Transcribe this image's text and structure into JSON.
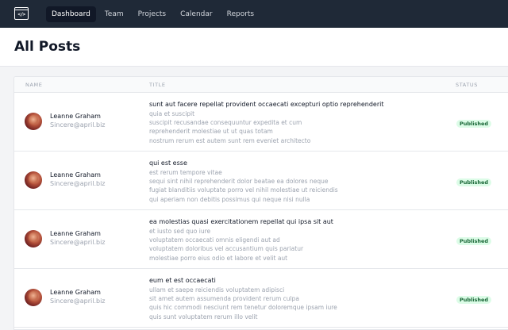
{
  "nav": {
    "logo_glyph": "</>",
    "links": [
      {
        "label": "Dashboard",
        "active": true
      },
      {
        "label": "Team",
        "active": false
      },
      {
        "label": "Projects",
        "active": false
      },
      {
        "label": "Calendar",
        "active": false
      },
      {
        "label": "Reports",
        "active": false
      }
    ]
  },
  "page": {
    "title": "All Posts"
  },
  "table": {
    "headers": {
      "name": "NAME",
      "title": "TITLE",
      "status": "STATUS"
    },
    "rows": [
      {
        "name": "Leanne Graham",
        "email": "Sincere@april.biz",
        "title": "sunt aut facere repellat provident occaecati excepturi optio reprehenderit",
        "body": [
          "quia et suscipit",
          "suscipit recusandae consequuntur expedita et cum",
          "reprehenderit molestiae ut ut quas totam",
          "nostrum rerum est autem sunt rem eveniet architecto"
        ],
        "status": "Published"
      },
      {
        "name": "Leanne Graham",
        "email": "Sincere@april.biz",
        "title": "qui est esse",
        "body": [
          "est rerum tempore vitae",
          "sequi sint nihil reprehenderit dolor beatae ea dolores neque",
          "fugiat blanditiis voluptate porro vel nihil molestiae ut reiciendis",
          "qui aperiam non debitis possimus qui neque nisi nulla"
        ],
        "status": "Published"
      },
      {
        "name": "Leanne Graham",
        "email": "Sincere@april.biz",
        "title": "ea molestias quasi exercitationem repellat qui ipsa sit aut",
        "body": [
          "et iusto sed quo iure",
          "voluptatem occaecati omnis eligendi aut ad",
          "voluptatem doloribus vel accusantium quis pariatur",
          "molestiae porro eius odio et labore et velit aut"
        ],
        "status": "Published"
      },
      {
        "name": "Leanne Graham",
        "email": "Sincere@april.biz",
        "title": "eum et est occaecati",
        "body": [
          "ullam et saepe reiciendis voluptatem adipisci",
          "sit amet autem assumenda provident rerum culpa",
          "quis hic commodi nesciunt rem tenetur doloremque ipsam iure",
          "quis sunt voluptatem rerum illo velit"
        ],
        "status": "Published"
      }
    ]
  },
  "colors": {
    "navbar_bg": "#1f2937",
    "active_nav_bg": "#111827",
    "badge_text": "#166534",
    "badge_bg": "#dcfce7"
  }
}
